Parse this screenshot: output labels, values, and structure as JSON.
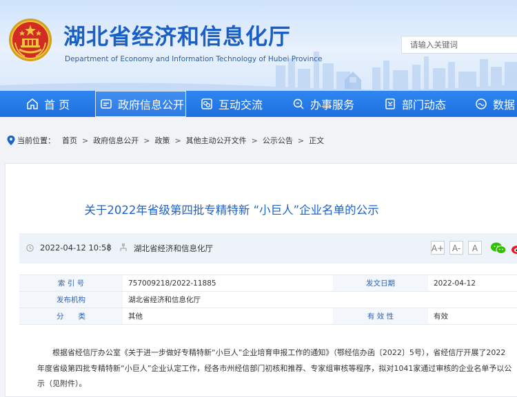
{
  "header": {
    "title": "湖北省经济和信息化厅",
    "subtitle": "Department of Economy and Information Technology of Hubei Province",
    "search_placeholder": "请输入关键词"
  },
  "nav": [
    {
      "label": "首 页",
      "icon": "home-icon",
      "active": false
    },
    {
      "label": "政府信息公开",
      "icon": "gov-info-icon",
      "active": true
    },
    {
      "label": "互动交流",
      "icon": "chat-icon",
      "active": false
    },
    {
      "label": "办事服务",
      "icon": "service-search-icon",
      "active": false
    },
    {
      "label": "部门动态",
      "icon": "department-news-icon",
      "active": false
    },
    {
      "label": "数据",
      "icon": "data-icon",
      "active": false
    }
  ],
  "breadcrumb": {
    "prefix": "当前位置：",
    "items": [
      "首页",
      "政府信息公开",
      "政策",
      "其他主动公开文件",
      "公示公告",
      "正文"
    ]
  },
  "article": {
    "title": "关于2022年省级第四批专精特新 “小巨人”企业名单的公示",
    "date": "2022-04-12 10:58",
    "divider": "|",
    "source": "湖北省经济和信息化厅",
    "font_buttons": [
      "A+",
      "A-",
      "A"
    ],
    "info": {
      "index_label": "索 引 号",
      "index_value": "757009218/2022-11885",
      "publish_date_label": "发文日期",
      "publish_date_value": "2022-04-12",
      "issuer_label": "发布机构",
      "issuer_value": "湖北省经济和信息化厅",
      "category_label": "分　　类",
      "category_value": "其他",
      "validity_label": "有 效 性",
      "validity_value": "有效"
    },
    "paragraph": "根据省经信厅办公室《关于进一步做好专精特新“小巨人”企业培育申报工作的通知》（鄂经信办函〔2022〕5号），省经信厅开展了2022年度省级第四批专精特新“小巨人”企业认定工作，经各市州经信部门初核和推荐、专家组审核等程序，拟对1041家通过审核的企业名单予以公示（见附件）。"
  },
  "colors": {
    "brand_blue": "#1d62c9",
    "nav_blue": "#2377e8",
    "meta_bg": "#eef3fa"
  }
}
